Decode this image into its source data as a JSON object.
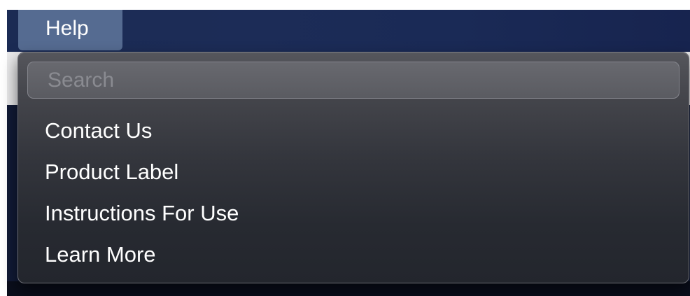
{
  "menubar": {
    "active_menu": "Help"
  },
  "help_menu": {
    "search": {
      "placeholder": "Search",
      "value": ""
    },
    "items": [
      {
        "label": "Contact Us"
      },
      {
        "label": "Product Label"
      },
      {
        "label": "Instructions For Use"
      },
      {
        "label": "Learn More"
      }
    ]
  },
  "colors": {
    "menubar_bg": "#1c2c57",
    "active_menu_highlight": "#556b91",
    "dropdown_bg": "#34363d",
    "text": "#ffffff"
  }
}
